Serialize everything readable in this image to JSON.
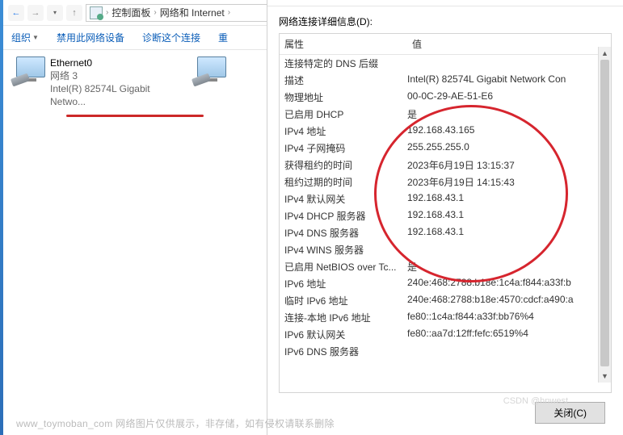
{
  "nav": {
    "crumb1": "控制面板",
    "crumb2": "网络和 Internet"
  },
  "toolbar": {
    "org": "组织",
    "disable": "禁用此网络设备",
    "diag": "诊断这个连接",
    "rename": "重"
  },
  "adapter": {
    "name": "Ethernet0",
    "network": "网络  3",
    "desc": "Intel(R) 82574L Gigabit Netwo..."
  },
  "dialog": {
    "label": "网络连接详细信息(D):",
    "col_prop": "属性",
    "col_val": "值",
    "close": "关闭(C)",
    "rows": [
      {
        "p": "连接特定的 DNS 后缀",
        "v": ""
      },
      {
        "p": "描述",
        "v": "Intel(R) 82574L Gigabit Network Con"
      },
      {
        "p": "物理地址",
        "v": "00-0C-29-AE-51-E6"
      },
      {
        "p": "已启用 DHCP",
        "v": "是"
      },
      {
        "p": "IPv4 地址",
        "v": "192.168.43.165"
      },
      {
        "p": "IPv4 子网掩码",
        "v": "255.255.255.0"
      },
      {
        "p": "获得租约的时间",
        "v": "2023年6月19日 13:15:37"
      },
      {
        "p": "租约过期的时间",
        "v": "2023年6月19日 14:15:43"
      },
      {
        "p": "IPv4 默认网关",
        "v": "192.168.43.1"
      },
      {
        "p": "IPv4 DHCP 服务器",
        "v": "192.168.43.1"
      },
      {
        "p": "IPv4 DNS 服务器",
        "v": "192.168.43.1"
      },
      {
        "p": "IPv4 WINS 服务器",
        "v": ""
      },
      {
        "p": "已启用 NetBIOS over Tc...",
        "v": "是"
      },
      {
        "p": "IPv6 地址",
        "v": "240e:468:2788:b18e:1c4a:f844:a33f:b"
      },
      {
        "p": "临时 IPv6 地址",
        "v": "240e:468:2788:b18e:4570:cdcf:a490:a"
      },
      {
        "p": "连接-本地 IPv6 地址",
        "v": "fe80::1c4a:f844:a33f:bb76%4"
      },
      {
        "p": "IPv6 默认网关",
        "v": "fe80::aa7d:12ff:fefc:6519%4"
      },
      {
        "p": "IPv6 DNS 服务器",
        "v": ""
      }
    ]
  },
  "footer": "www_toymoban_com 网络图片仅供展示，非存储，如有侵权请联系删除",
  "watermark": "CSDN @hnwest"
}
